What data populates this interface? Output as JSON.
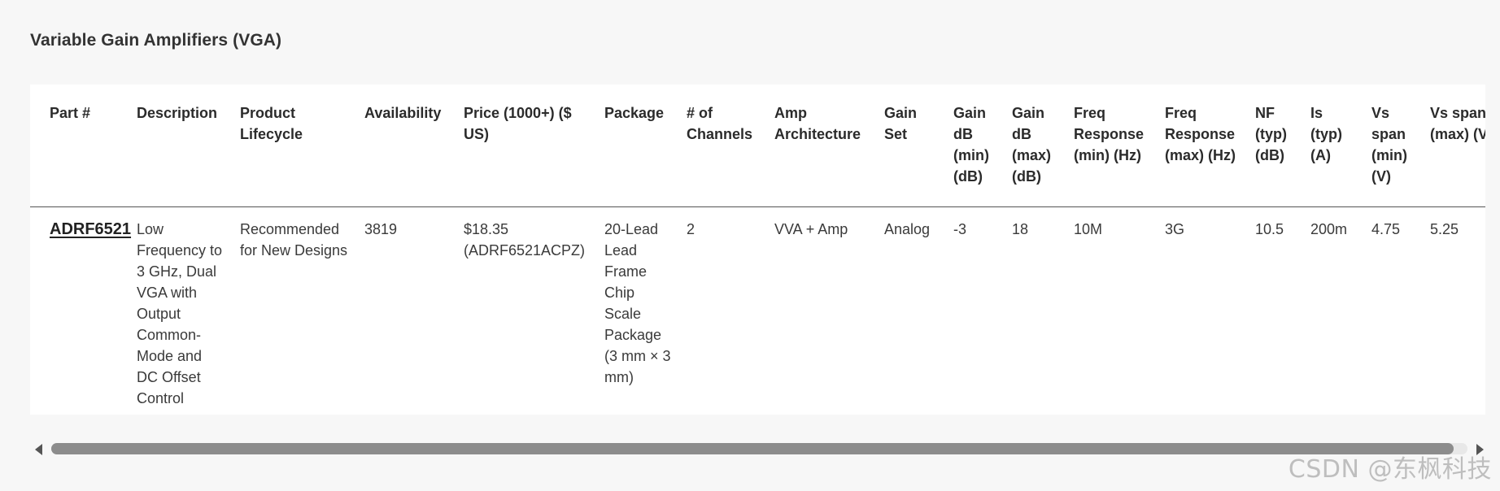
{
  "section": {
    "title": "Variable Gain Amplifiers (VGA)"
  },
  "table": {
    "headers": [
      "Part #",
      "Description",
      "Product Lifecycle",
      "Availability",
      "Price (1000+) ($ US)",
      "Package",
      "# of Channels",
      "Amp Architecture",
      "Gain Set",
      "Gain dB (min) (dB)",
      "Gain dB (max) (dB)",
      "Freq Response (min) (Hz)",
      "Freq Response (max) (Hz)",
      "NF (typ) (dB)",
      "Is (typ) (A)",
      "Vs span (min) (V)",
      "Vs span (max) (V)"
    ],
    "rows": [
      {
        "part": "ADRF6521",
        "description": "Low Frequency to 3 GHz, Dual VGA with Output Common-Mode and DC Offset Control",
        "lifecycle": "Recommended for New Designs",
        "availability": "3819",
        "price": "$18.35 (ADRF6521ACPZ)",
        "package": "20-Lead Lead Frame Chip Scale Package (3 mm × 3 mm)",
        "channels": "2",
        "architecture": "VVA + Amp",
        "gain_set": "Analog",
        "gain_min": "-3",
        "gain_max": "18",
        "freq_min": "10M",
        "freq_max": "3G",
        "nf_typ": "10.5",
        "is_typ": "200m",
        "vs_min": "4.75",
        "vs_max": "5.25"
      }
    ]
  },
  "scrollbar": {
    "position_fraction": 0.99
  },
  "watermark": {
    "text": "CSDN @东枫科技"
  }
}
